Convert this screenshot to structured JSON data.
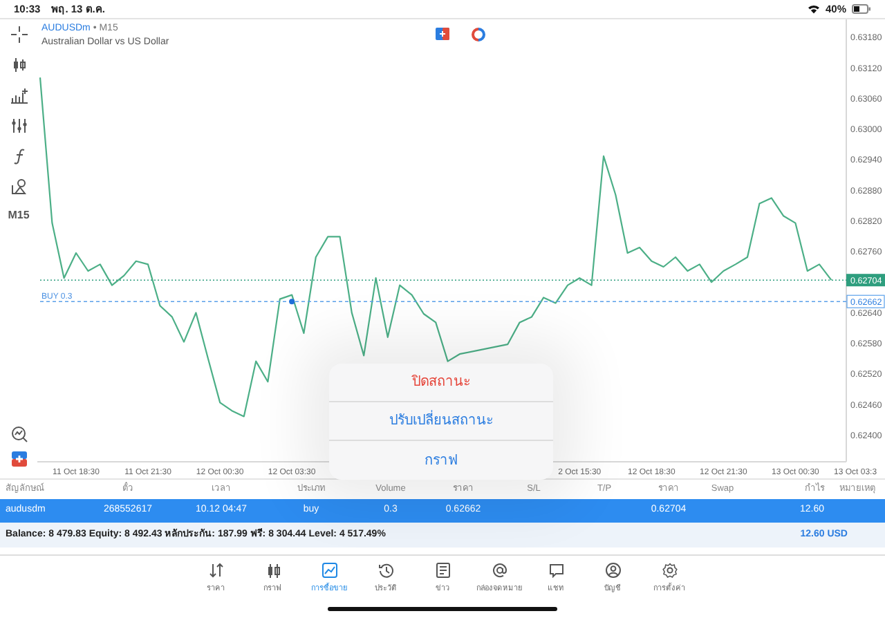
{
  "status_bar": {
    "time": "10:33",
    "date": "พฤ. 13 ต.ค.",
    "battery": "40%"
  },
  "toolbar": {
    "timeframe": "M15"
  },
  "chart": {
    "symbol": "AUDUSDm",
    "title_suffix": "• M15",
    "description": "Australian Dollar vs US Dollar",
    "chart_data": {
      "type": "line",
      "categories": [
        null,
        null,
        null,
        "11 Oct 18:30",
        null,
        null,
        null,
        null,
        null,
        "11 Oct 21:30",
        null,
        null,
        null,
        null,
        null,
        "12 Oct 00:30",
        null,
        null,
        null,
        null,
        null,
        "12 Oct 03:30",
        null,
        null,
        null,
        null,
        null,
        null,
        null,
        null,
        null,
        null,
        null,
        null,
        null,
        null,
        null,
        null,
        null,
        null,
        null,
        null,
        null,
        null,
        null,
        "2 Oct 15:30",
        null,
        null,
        null,
        null,
        null,
        "12 Oct 18:30",
        null,
        null,
        null,
        null,
        null,
        "12 Oct 21:30",
        null,
        null,
        null,
        null,
        null,
        "13 Oct 00:30",
        null,
        null,
        null,
        null,
        "13 Oct 03:3"
      ],
      "series": [
        {
          "color": "#4caf87",
          "values": [
            0.63101,
            0.62816,
            0.62708,
            0.62757,
            0.62722,
            0.62735,
            0.62694,
            0.62713,
            0.62741,
            0.62735,
            0.62654,
            0.62632,
            0.62583,
            0.6264,
            0.62551,
            0.62464,
            0.62448,
            0.62437,
            0.62545,
            0.62505,
            0.62667,
            0.62675,
            0.626,
            0.62749,
            0.62789,
            0.62789,
            0.6264,
            0.62556,
            0.62708,
            0.62592,
            0.62694,
            0.62675,
            0.62638,
            0.62621,
            0.62545,
            0.62559,
            null,
            null,
            null,
            0.62578,
            0.62621,
            0.62632,
            0.6267,
            0.62659,
            0.62694,
            0.62708,
            0.62694,
            0.62947,
            0.62871,
            0.62757,
            0.62768,
            0.62741,
            0.6273,
            0.62749,
            0.62722,
            0.62735,
            0.627,
            0.62722,
            0.62735,
            0.62749,
            0.62854,
            0.62865,
            0.6283,
            0.62816,
            0.62722,
            0.62735,
            0.62704,
            null,
            null
          ]
        },
        {
          "color": "#2e9e7e",
          "line_style": "dotted",
          "values": [
            0.62704,
            0.62704,
            0.62704,
            0.62704,
            0.62704,
            0.62704,
            0.62704,
            0.62704,
            0.62704,
            0.62704,
            0.62704,
            0.62704,
            0.62704,
            0.62704,
            0.62704,
            0.62704,
            0.62704,
            0.62704,
            0.62704,
            0.62704,
            0.62704,
            0.62704,
            0.62704,
            0.62704,
            0.62704,
            0.62704,
            0.62704,
            0.62704,
            0.62704,
            0.62704,
            0.62704,
            0.62704,
            0.62704,
            0.62704,
            0.62704,
            0.62704,
            0.62704,
            0.62704,
            0.62704,
            0.62704,
            0.62704,
            0.62704,
            0.62704,
            0.62704,
            0.62704,
            0.62704,
            0.62704,
            0.62704,
            0.62704,
            0.62704,
            0.62704,
            0.62704,
            0.62704,
            0.62704,
            0.62704,
            0.62704,
            0.62704,
            0.62704,
            0.62704,
            0.62704,
            0.62704,
            0.62704,
            0.62704,
            0.62704,
            0.62704,
            0.62704,
            0.62704,
            0.62704,
            0.62704
          ]
        },
        {
          "color": "#5aa0ea",
          "line_style": "dashed",
          "values": [
            0.62662,
            0.62662,
            0.62662,
            0.62662,
            0.62662,
            0.62662,
            0.62662,
            0.62662,
            0.62662,
            0.62662,
            0.62662,
            0.62662,
            0.62662,
            0.62662,
            0.62662,
            0.62662,
            0.62662,
            0.62662,
            0.62662,
            0.62662,
            0.62662,
            0.62662,
            0.62662,
            0.62662,
            0.62662,
            0.62662,
            0.62662,
            0.62662,
            0.62662,
            0.62662,
            0.62662,
            0.62662,
            0.62662,
            0.62662,
            0.62662,
            0.62662,
            0.62662,
            0.62662,
            0.62662,
            0.62662,
            0.62662,
            0.62662,
            0.62662,
            0.62662,
            0.62662,
            0.62662,
            0.62662,
            0.62662,
            0.62662,
            0.62662,
            0.62662,
            0.62662,
            0.62662,
            0.62662,
            0.62662,
            0.62662,
            0.62662,
            0.62662,
            0.62662,
            0.62662,
            0.62662,
            0.62662,
            0.62662,
            0.62662,
            0.62662,
            0.62662,
            0.62662,
            0.62662,
            0.62662
          ]
        }
      ],
      "ylim": [
        0.62348,
        0.63215
      ],
      "yticks": [
        {
          "value": 0.6318,
          "label": "0.63180"
        },
        {
          "value": 0.6312,
          "label": "0.63120"
        },
        {
          "value": 0.6306,
          "label": "0.63060"
        },
        {
          "value": 0.63,
          "label": "0.63000"
        },
        {
          "value": 0.6294,
          "label": "0.62940"
        },
        {
          "value": 0.6288,
          "label": "0.62880"
        },
        {
          "value": 0.6282,
          "label": "0.62820"
        },
        {
          "value": 0.6276,
          "label": "0.62760"
        },
        {
          "value": 0.6264,
          "label": "0.62640"
        },
        {
          "value": 0.6258,
          "label": "0.62580"
        },
        {
          "value": 0.6252,
          "label": "0.62520"
        },
        {
          "value": 0.6246,
          "label": "0.62460"
        },
        {
          "value": 0.624,
          "label": "0.62400"
        }
      ],
      "annotations": [
        "BUY 0.3"
      ]
    },
    "price_tags": [
      "0.62704",
      "0.62662"
    ]
  },
  "action_sheet": [
    {
      "label": "ปิดสถานะ",
      "kind": "destructive"
    },
    {
      "label": "ปรับเปลี่ยนสถานะ",
      "kind": "default"
    },
    {
      "label": "กราฟ",
      "kind": "default"
    }
  ],
  "positions": {
    "columns": [
      "สัญลักษณ์",
      "ตั๋ว",
      "เวลา",
      "ประเภท",
      "Volume",
      "ราคา",
      "S/L",
      "T/P",
      "ราคา",
      "Swap",
      "กำไร",
      "หมายเหตุ"
    ],
    "rows": [
      {
        "symbol": "audusdm",
        "ticket": "268552617",
        "time": "10.12 04:47",
        "type": "buy",
        "volume": "0.3",
        "open_price": "0.62662",
        "current_price": "0.62704",
        "profit": "12.60",
        "selected": true
      }
    ]
  },
  "summary": {
    "text": "Balance: 8 479.83 Equity: 8 492.43 หลักประกัน: 187.99 ฟรี: 8 304.44 Level: 4 517.49%",
    "total": "12.60 USD"
  },
  "tab_bar": [
    {
      "label": "ราคา",
      "selected": false
    },
    {
      "label": "กราฟ",
      "selected": false
    },
    {
      "label": "การซื้อขาย",
      "selected": true
    },
    {
      "label": "ประวัติ",
      "selected": false
    },
    {
      "label": "ข่าว",
      "selected": false
    },
    {
      "label": "กล่องจดหมาย",
      "selected": false
    },
    {
      "label": "แชท",
      "selected": false
    },
    {
      "label": "บัญชี",
      "selected": false
    },
    {
      "label": "การตั้งค่า",
      "selected": false
    }
  ]
}
